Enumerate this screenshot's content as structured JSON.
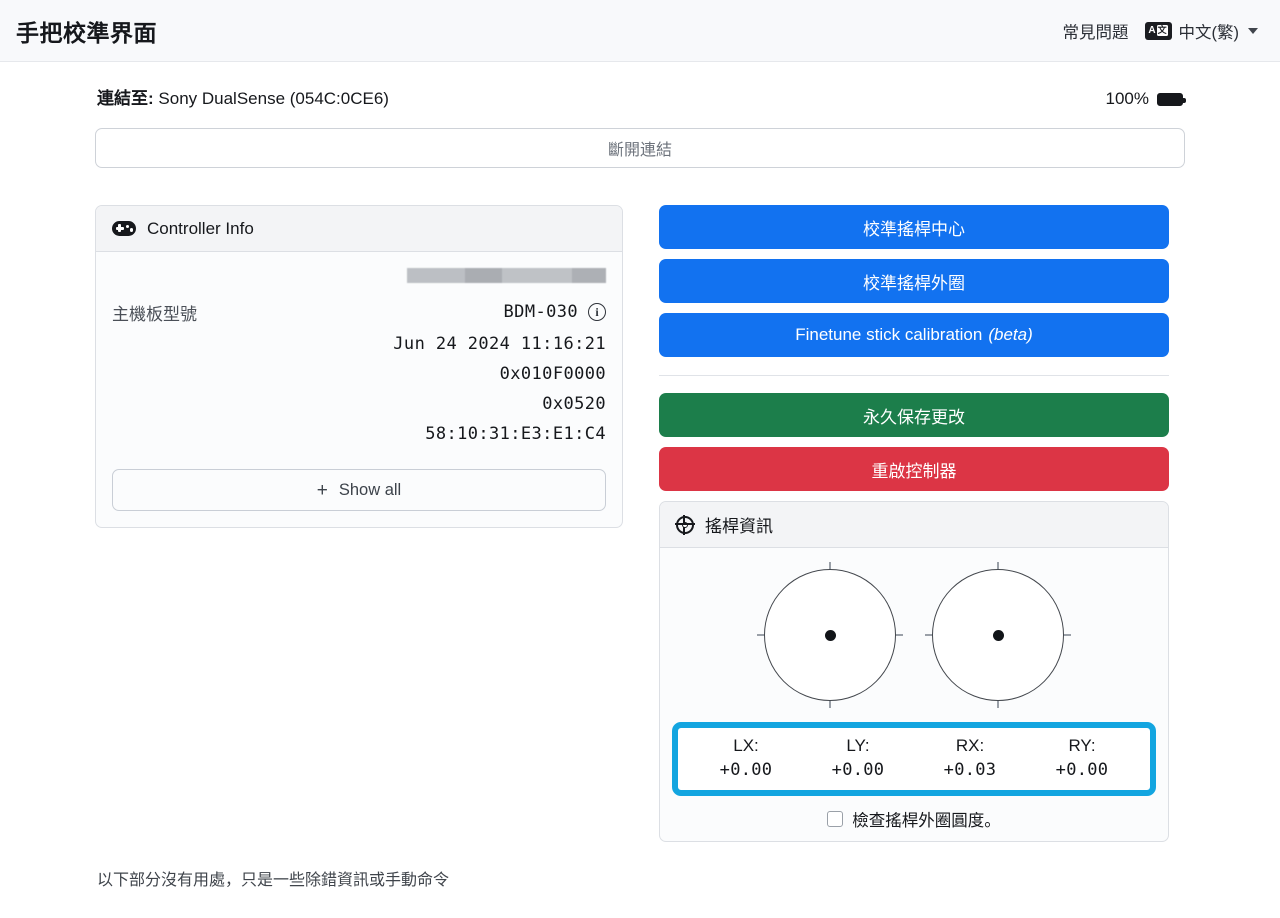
{
  "header": {
    "title": "手把校準界面",
    "faq_label": "常見問題",
    "language_label": "中文(繁)",
    "translate_icon_a": "A",
    "translate_icon_z": "文"
  },
  "connection": {
    "label": "連結至:",
    "device": " Sony DualSense (054C:0CE6)",
    "battery_percent": "100%",
    "disconnect_label": "斷開連結"
  },
  "controller_info": {
    "card_title": "Controller Info",
    "redacted_segments": [
      "#b9bcc1",
      "#a6a9af",
      "#bcbfc4",
      "#a9acb2"
    ],
    "board_model_label": "主機板型號",
    "board_model_value": "BDM-030",
    "info_icon_glyph": "i",
    "rows": [
      "Jun 24 2024 11:16:21",
      "0x010F0000",
      "0x0520",
      "58:10:31:E3:E1:C4"
    ],
    "show_all_label": "Show all",
    "show_all_plus": "+"
  },
  "actions": {
    "calibrate_center": "校準搖桿中心",
    "calibrate_range": "校準搖桿外圈",
    "finetune_main": "Finetune stick calibration",
    "finetune_beta": "(beta)",
    "save_permanently": "永久保存更改",
    "reboot_controller": "重啟控制器"
  },
  "stick_info": {
    "card_title": "搖桿資訊",
    "values": [
      {
        "label": "LX:",
        "value": "+0.00"
      },
      {
        "label": "LY:",
        "value": "+0.00"
      },
      {
        "label": "RX:",
        "value": "+0.03"
      },
      {
        "label": "RY:",
        "value": "+0.00"
      }
    ],
    "checkbox_label": "檢查搖桿外圈圓度。",
    "checkbox_checked": false
  },
  "footer": {
    "note": "以下部分沒有用處，只是一些除錯資訊或手動命令"
  },
  "colors": {
    "accent_blue": "#1272f0",
    "success_green": "#1c7e4b",
    "danger_red": "#dc3545",
    "highlight_cyan": "#13a5e0"
  }
}
